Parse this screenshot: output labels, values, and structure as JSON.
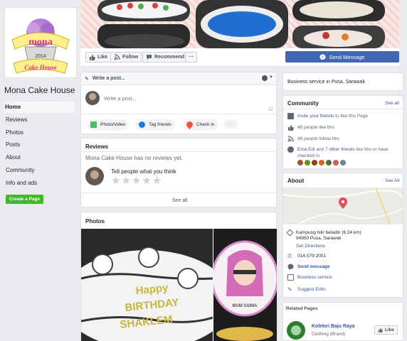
{
  "page": {
    "name": "Mona Cake House",
    "logo_line1": "mona",
    "logo_year": "2014",
    "logo_line2": "Cake House"
  },
  "nav": {
    "items": [
      {
        "label": "Home",
        "active": true
      },
      {
        "label": "Reviews"
      },
      {
        "label": "Photos"
      },
      {
        "label": "Posts"
      },
      {
        "label": "About"
      },
      {
        "label": "Community"
      },
      {
        "label": "Info and ads"
      }
    ],
    "create_page": "Create a Page"
  },
  "actions": {
    "like": "Like",
    "follow": "Follow",
    "recommend": "Recommend",
    "more": "···",
    "send_message": "Send Message"
  },
  "composer": {
    "header": "Write a post...",
    "placeholder": "Write a post...",
    "photo_video": "Photo/Video",
    "tag_friends": "Tag friends",
    "check_in": "Check in",
    "more": "···"
  },
  "reviews": {
    "title": "Reviews",
    "empty": "Mona Cake House has no reviews yet.",
    "prompt": "Tell people what you think",
    "see_all": "See all",
    "stars": 5
  },
  "photos": {
    "title": "Photos",
    "cake1_text": [
      "Happy",
      "BIRTHDAY",
      "SHAKLEM"
    ],
    "cake2_text": "MUM SSIMA"
  },
  "business": {
    "text": "Business service in Pusa, Sarawak"
  },
  "community": {
    "title": "Community",
    "see_all": "See all",
    "invite": "Invite your friends",
    "invite_rest": " to like this Page",
    "likes": "48 people like this",
    "follows": "48 people follow this",
    "checked_in_names": "Ema Edi",
    "checked_in_and": " and ",
    "checked_in_others": "7 other friends",
    "checked_in_rest": " like this or have checked in"
  },
  "about": {
    "title": "About",
    "see_all": "See All",
    "address_line1": "Kampung hilir beladin (6.24 km)",
    "address_line2": "94950 Pusa, Sarawak",
    "directions": "Get Directions",
    "phone": "014-579 2001",
    "message": "Send message",
    "category": "Business service",
    "suggest": "Suggest Edits"
  },
  "related": {
    "title": "Related Pages",
    "name": "Kolekei Baju Raya",
    "category": "Clothing (Brand)",
    "like": "Like"
  },
  "colors": {
    "fb_blue": "#4267b2",
    "link_blue": "#385898",
    "green": "#42b72a",
    "map_pin": "#e74c5b"
  }
}
